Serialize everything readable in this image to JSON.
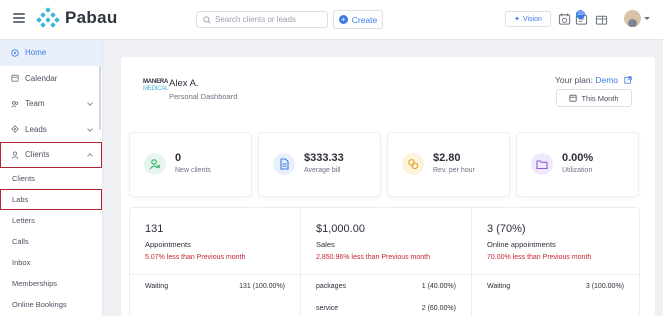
{
  "app": {
    "name": "Pabau",
    "accent": "#3c7be6",
    "logo_color": "#3fb5d8"
  },
  "header": {
    "search_placeholder": "Search clients or leads",
    "create_label": "Create",
    "vision_label": "Vision",
    "notifications_count": "10"
  },
  "sidebar": {
    "items": [
      {
        "label": "Home",
        "icon": "home-icon"
      },
      {
        "label": "Calendar",
        "icon": "calendar-icon"
      },
      {
        "label": "Team",
        "icon": "team-icon"
      },
      {
        "label": "Leads",
        "icon": "leads-icon"
      },
      {
        "label": "Clients",
        "icon": "user-icon"
      }
    ],
    "sub_items": [
      "Clients",
      "Labs",
      "Letters",
      "Calls",
      "Inbox",
      "Memberships",
      "Online Bookings"
    ]
  },
  "dashboard": {
    "brand_top": "MANERA",
    "brand_bottom": "MEDICAL",
    "user_name": "Alex A.",
    "user_role": "Personal Dashboard",
    "plan_label": "Your plan:",
    "plan_value": "Demo",
    "period_label": "This Month"
  },
  "stats": [
    {
      "value": "0",
      "label": "New clients",
      "icon": "new-clients-icon",
      "color": "#2fae67",
      "bg": "#e6f6ee"
    },
    {
      "value": "$333.33",
      "label": "Average bill",
      "icon": "document-icon",
      "color": "#3c7be6",
      "bg": "#e8f0fd"
    },
    {
      "value": "$2.80",
      "label": "Rev. per hour",
      "icon": "coins-icon",
      "color": "#e0a526",
      "bg": "#fcf3dc"
    },
    {
      "value": "0.00%",
      "label": "Utilization",
      "icon": "folder-icon",
      "color": "#8b5cd6",
      "bg": "#f0e9fb"
    }
  ],
  "metrics": [
    {
      "value": "131",
      "label": "Appointments",
      "change": "5.07% less than Previous month",
      "rows": [
        {
          "name": "Waiting",
          "value": "131 (100.00%)"
        }
      ]
    },
    {
      "value": "$1,000.00",
      "label": "Sales",
      "change": "2,850.96% less than Previous month",
      "rows": [
        {
          "name": "packages",
          "value": "1 (40.00%)"
        },
        {
          "name": "service",
          "value": "2 (60.00%)"
        }
      ]
    },
    {
      "value": "3 (70%)",
      "label": "Online appointments",
      "change": "70.00% less than Previous month",
      "rows": [
        {
          "name": "Waiting",
          "value": "3 (100.00%)"
        }
      ]
    }
  ]
}
